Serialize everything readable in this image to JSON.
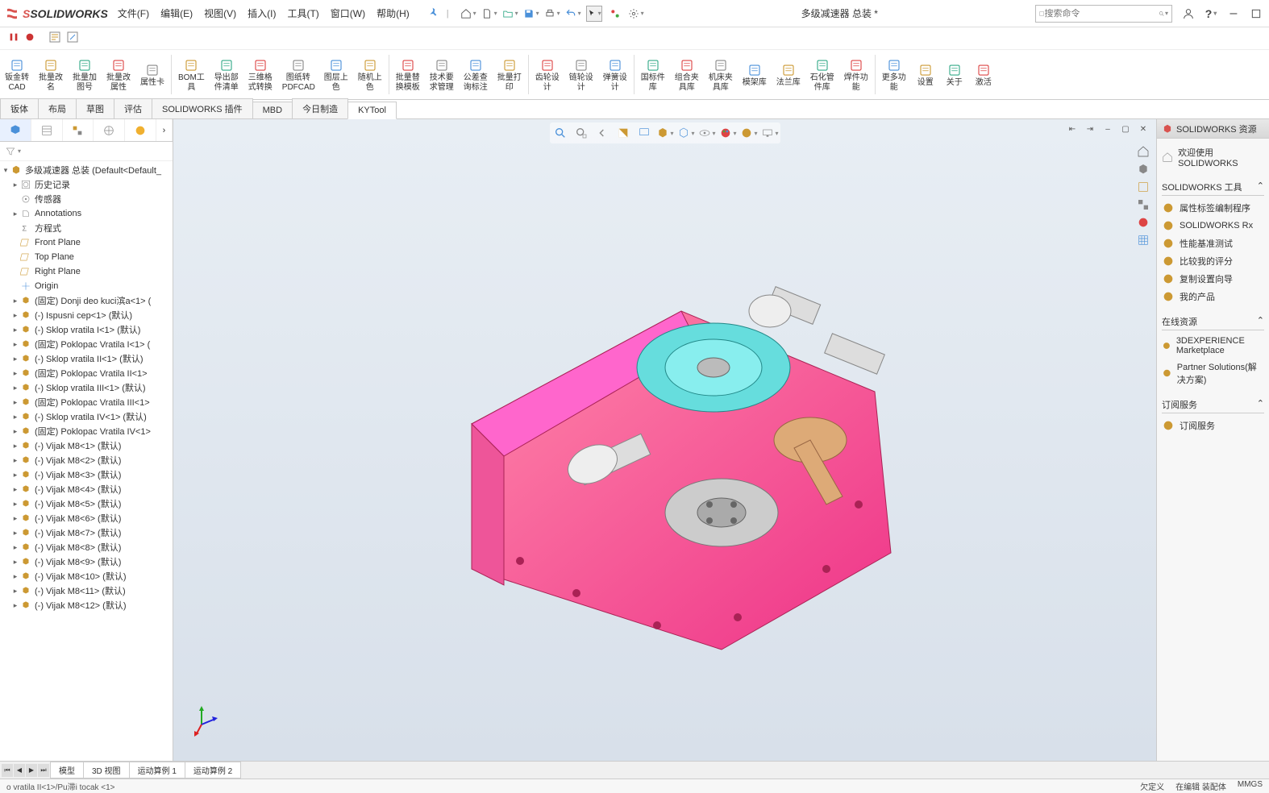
{
  "logo": {
    "brand_s": "S",
    "brand_rest": "SOLIDWORKS"
  },
  "menus": [
    "文件(F)",
    "编辑(E)",
    "视图(V)",
    "插入(I)",
    "工具(T)",
    "窗口(W)",
    "帮助(H)"
  ],
  "document_title": "多级减速器 总装 *",
  "search_placeholder": "搜索命令",
  "ribbon_buttons": [
    {
      "l": "钣金转\nCAD"
    },
    {
      "l": "批量改\n名"
    },
    {
      "l": "批量加\n图号"
    },
    {
      "l": "批量改\n属性"
    },
    {
      "l": "属性卡"
    },
    {
      "sep": true
    },
    {
      "l": "BOM工\n具"
    },
    {
      "l": "导出部\n件清单"
    },
    {
      "l": "三维格\n式转换"
    },
    {
      "l": "图纸转\nPDFCAD"
    },
    {
      "l": "图层上\n色"
    },
    {
      "l": "随机上\n色"
    },
    {
      "sep": true
    },
    {
      "l": "批量替\n换模板"
    },
    {
      "l": "技术要\n求管理"
    },
    {
      "l": "公差查\n询标注"
    },
    {
      "l": "批量打\n印"
    },
    {
      "sep": true
    },
    {
      "l": "齿轮设\n计"
    },
    {
      "l": "链轮设\n计"
    },
    {
      "l": "弹簧设\n计"
    },
    {
      "sep": true
    },
    {
      "l": "国标件\n库"
    },
    {
      "l": "组合夹\n具库"
    },
    {
      "l": "机床夹\n具库"
    },
    {
      "l": "模架库"
    },
    {
      "l": "法兰库"
    },
    {
      "l": "石化管\n件库"
    },
    {
      "l": "焊件功\n能"
    },
    {
      "sep": true
    },
    {
      "l": "更多功\n能"
    },
    {
      "l": "设置"
    },
    {
      "l": "关于"
    },
    {
      "l": "激活"
    }
  ],
  "doc_tabs": [
    "钣体",
    "布局",
    "草图",
    "评估",
    "SOLIDWORKS 插件",
    "MBD",
    "今日制造",
    "KYTool"
  ],
  "active_doc_tab": "KYTool",
  "feature_tree_root": "多级减速器 总装  (Default<Default_",
  "feature_tree": [
    {
      "i": "history",
      "t": "历史记录",
      "c": true
    },
    {
      "i": "sensor",
      "t": "传感器"
    },
    {
      "i": "anno",
      "t": "Annotations",
      "c": true
    },
    {
      "i": "eq",
      "t": "方程式"
    },
    {
      "i": "plane",
      "t": "Front Plane"
    },
    {
      "i": "plane",
      "t": "Top Plane"
    },
    {
      "i": "plane",
      "t": "Right Plane"
    },
    {
      "i": "origin",
      "t": "Origin"
    },
    {
      "i": "part",
      "t": "(固定) Donji deo kuci滨a<1> (",
      "c": true
    },
    {
      "i": "part",
      "t": "(-) Ispusni cep<1> (默认)",
      "c": true
    },
    {
      "i": "part",
      "t": "(-) Sklop vratila I<1> (默认)",
      "c": true
    },
    {
      "i": "part",
      "t": "(固定) Poklopac Vratila I<1> (",
      "c": true
    },
    {
      "i": "part",
      "t": "(-) Sklop vratila II<1> (默认)",
      "c": true
    },
    {
      "i": "part",
      "t": "(固定) Poklopac Vratila II<1>",
      "c": true
    },
    {
      "i": "part",
      "t": "(-) Sklop vratila III<1> (默认)",
      "c": true
    },
    {
      "i": "part",
      "t": "(固定) Poklopac Vratila III<1>",
      "c": true
    },
    {
      "i": "part",
      "t": "(-) Sklop vratila IV<1> (默认)",
      "c": true
    },
    {
      "i": "part",
      "t": "(固定) Poklopac Vratila IV<1>",
      "c": true
    },
    {
      "i": "part",
      "t": "(-) Vijak M8<1> (默认)",
      "c": true
    },
    {
      "i": "part",
      "t": "(-) Vijak M8<2> (默认)",
      "c": true
    },
    {
      "i": "part",
      "t": "(-) Vijak M8<3> (默认)",
      "c": true
    },
    {
      "i": "part",
      "t": "(-) Vijak M8<4> (默认)",
      "c": true
    },
    {
      "i": "part",
      "t": "(-) Vijak M8<5> (默认)",
      "c": true
    },
    {
      "i": "part",
      "t": "(-) Vijak M8<6> (默认)",
      "c": true
    },
    {
      "i": "part",
      "t": "(-) Vijak M8<7> (默认)",
      "c": true
    },
    {
      "i": "part",
      "t": "(-) Vijak M8<8> (默认)",
      "c": true
    },
    {
      "i": "part",
      "t": "(-) Vijak M8<9> (默认)",
      "c": true
    },
    {
      "i": "part",
      "t": "(-) Vijak M8<10> (默认)",
      "c": true
    },
    {
      "i": "part",
      "t": "(-) Vijak M8<11> (默认)",
      "c": true
    },
    {
      "i": "part",
      "t": "(-) Vijak M8<12> (默认)",
      "c": true
    }
  ],
  "task_panel": {
    "header": "SOLIDWORKS 资源",
    "welcome": "欢迎使用 SOLIDWORKS",
    "tools_title": "SOLIDWORKS 工具",
    "tools": [
      "属性标签编制程序",
      "SOLIDWORKS Rx",
      "性能基准测试",
      "比较我的评分",
      "复制设置向导",
      "我的产品"
    ],
    "online_title": "在线资源",
    "online": [
      "3DEXPERIENCE Marketplace",
      "Partner Solutions(解决方案)"
    ],
    "sub_title": "订阅服务",
    "sub": [
      "订阅服务"
    ]
  },
  "bottom_tabs": [
    "模型",
    "3D 视图",
    "运动算例 1",
    "运动算例 2"
  ],
  "status": {
    "left": "o vratila II<1>/Pu滞i tocak <1>",
    "r1": "欠定义",
    "r2": "在编辑 装配体",
    "r3": "MMGS"
  }
}
